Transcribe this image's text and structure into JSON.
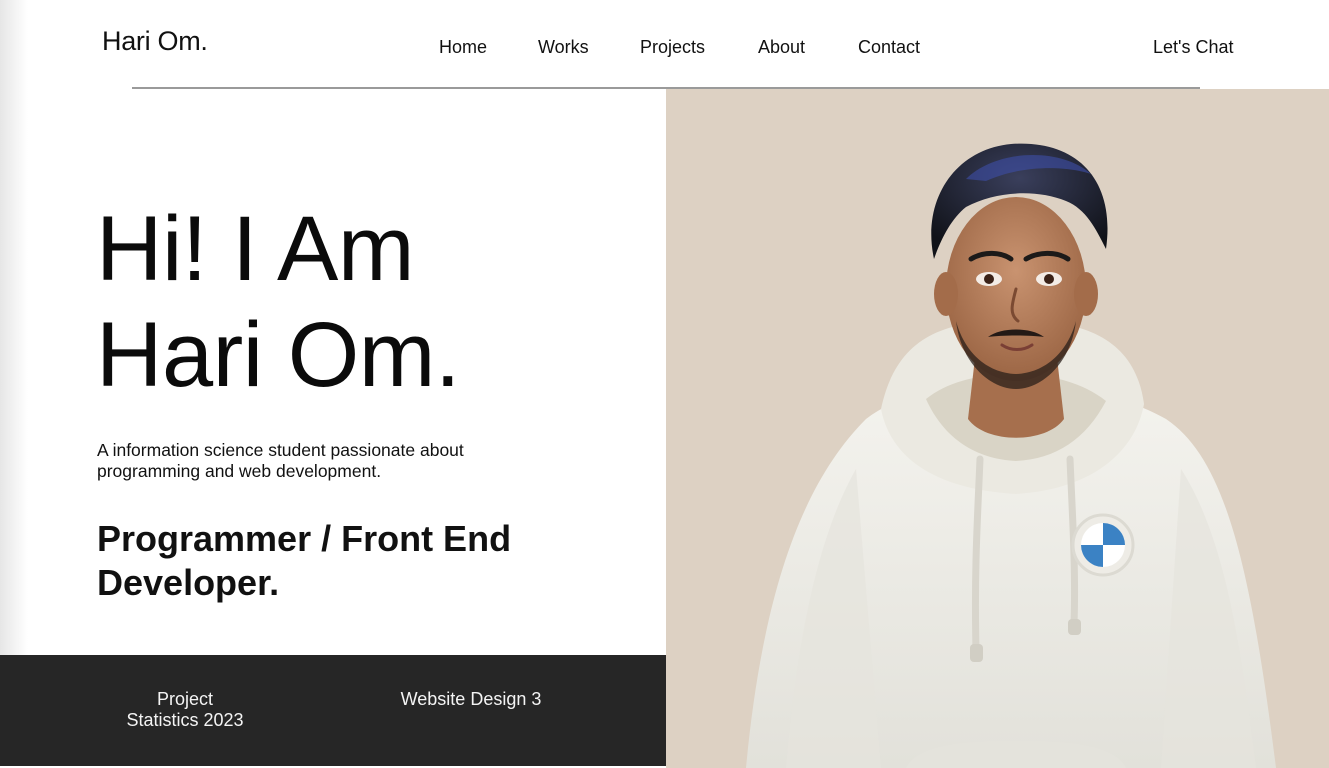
{
  "header": {
    "logo": "Hari Om.",
    "nav": [
      {
        "label": "Home",
        "id": "home"
      },
      {
        "label": "Works",
        "id": "works"
      },
      {
        "label": "Projects",
        "id": "projects"
      },
      {
        "label": "About",
        "id": "about"
      },
      {
        "label": "Contact",
        "id": "contact"
      }
    ],
    "cta_label": "Let's Chat"
  },
  "hero": {
    "title_line1": "Hi! I Am",
    "title_line2": "Hari Om.",
    "description": "A information science student passionate about programming and web development.",
    "role_line1": "Programmer / Front End",
    "role_line2": "Developer."
  },
  "stats": {
    "item1_line1": "Project",
    "item1_line2": "Statistics 2023",
    "item2": "Website Design 3"
  },
  "image": {
    "subject": "avatar-portrait",
    "background_color": "#ddd1c3"
  },
  "colors": {
    "dark_bar": "#262626",
    "text": "#111111",
    "divider": "#9a9a9a"
  }
}
